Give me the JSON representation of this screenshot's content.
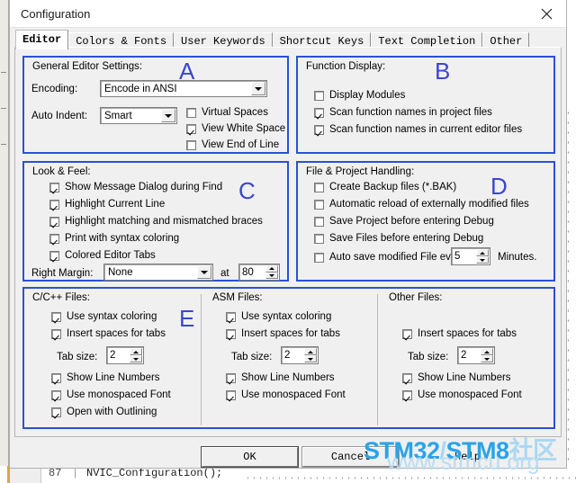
{
  "window": {
    "title": "Configuration",
    "close_icon": "close-icon"
  },
  "tabs": [
    {
      "label": "Editor",
      "selected": true
    },
    {
      "label": "Colors & Fonts",
      "selected": false
    },
    {
      "label": "User Keywords",
      "selected": false
    },
    {
      "label": "Shortcut Keys",
      "selected": false
    },
    {
      "label": "Text Completion",
      "selected": false
    },
    {
      "label": "Other",
      "selected": false
    }
  ],
  "groups": {
    "general_editor": {
      "annotation": "A",
      "title": "General Editor Settings:",
      "encoding_label": "Encoding:",
      "encoding_value": "Encode in ANSI",
      "auto_indent_label": "Auto Indent:",
      "auto_indent_value": "Smart",
      "checks": [
        {
          "label": "Virtual Spaces",
          "checked": false
        },
        {
          "label": "View White Space",
          "checked": true
        },
        {
          "label": "View End of Line",
          "checked": false
        }
      ]
    },
    "function_display": {
      "annotation": "B",
      "title": "Function Display:",
      "checks": [
        {
          "label": "Display Modules",
          "checked": false
        },
        {
          "label": "Scan function names in project files",
          "checked": true
        },
        {
          "label": "Scan function names in current editor files",
          "checked": true
        }
      ]
    },
    "look_feel": {
      "annotation": "C",
      "title": "Look & Feel:",
      "checks": [
        {
          "label": "Show Message Dialog during Find",
          "checked": true
        },
        {
          "label": "Highlight Current Line",
          "checked": true
        },
        {
          "label": "Highlight matching and mismatched braces",
          "checked": true
        },
        {
          "label": "Print with syntax coloring",
          "checked": true
        },
        {
          "label": "Colored Editor Tabs",
          "checked": true
        }
      ],
      "right_margin_label": "Right Margin:",
      "right_margin_value": "None",
      "at_label": "at",
      "at_value": "80"
    },
    "file_project": {
      "annotation": "D",
      "title": "File & Project Handling:",
      "checks": [
        {
          "label": "Create Backup files (*.BAK)",
          "checked": false
        },
        {
          "label": "Automatic reload of externally modified files",
          "checked": false
        },
        {
          "label": "Save Project before entering Debug",
          "checked": false
        },
        {
          "label": "Save Files before entering Debug",
          "checked": false
        },
        {
          "label": "Auto save modified File every",
          "checked": false
        }
      ],
      "autosave_minutes": "5",
      "autosave_suffix": "Minutes."
    },
    "file_types": {
      "annotation": "E",
      "columns": [
        {
          "title": "C/C++ Files:",
          "checks_top": [
            {
              "label": "Use syntax coloring",
              "checked": true
            },
            {
              "label": "Insert spaces for tabs",
              "checked": true
            }
          ],
          "tab_size_label": "Tab size:",
          "tab_size_value": "2",
          "checks_bottom": [
            {
              "label": "Show Line Numbers",
              "checked": true
            },
            {
              "label": "Use monospaced Font",
              "checked": true
            },
            {
              "label": "Open with Outlining",
              "checked": true
            }
          ]
        },
        {
          "title": "ASM Files:",
          "checks_top": [
            {
              "label": "Use syntax coloring",
              "checked": true
            },
            {
              "label": "Insert spaces for tabs",
              "checked": true
            }
          ],
          "tab_size_label": "Tab size:",
          "tab_size_value": "2",
          "checks_bottom": [
            {
              "label": "Show Line Numbers",
              "checked": true
            },
            {
              "label": "Use monospaced Font",
              "checked": true
            }
          ]
        },
        {
          "title": "Other Files:",
          "checks_top": [
            {
              "label": "Insert spaces for tabs",
              "checked": true
            }
          ],
          "tab_size_label": "Tab size:",
          "tab_size_value": "2",
          "checks_bottom": [
            {
              "label": "Show Line Numbers",
              "checked": true
            },
            {
              "label": "Use monospaced Font",
              "checked": true
            }
          ]
        }
      ]
    }
  },
  "buttons": {
    "ok": "OK",
    "cancel": "Cancel",
    "help": "Help"
  },
  "watermark": {
    "line1_part1": "STM32",
    "line1_part2": "/",
    "line1_part3": "STM8",
    "line1_part4": "社区",
    "line2": "www.stmcu.org"
  },
  "background_editor": {
    "line_number": "87",
    "separator": "|",
    "code": "  NVIC_Configuration();"
  },
  "colors": {
    "group_border": "#2b50d8",
    "annotation": "#3a46cf",
    "dialog_bg": "#f0f0f0",
    "watermark_blue": "#2aa3e8"
  }
}
